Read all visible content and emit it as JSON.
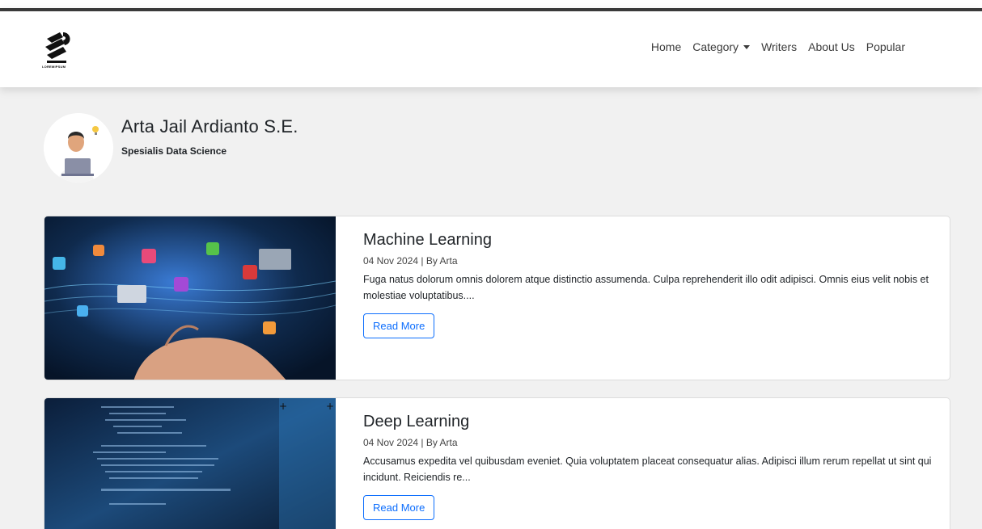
{
  "header": {
    "logo_text": "LOREMIPSUM",
    "nav": {
      "home": "Home",
      "category": "Category",
      "writers": "Writers",
      "about": "About Us",
      "popular": "Popular"
    }
  },
  "profile": {
    "name": "Arta Jail Ardianto S.E.",
    "role": "Spesialis Data Science"
  },
  "articles": [
    {
      "title": "Machine Learning",
      "meta": "04 Nov 2024 | By Arta",
      "excerpt": "Fuga natus dolorum omnis dolorem atque distinctio assumenda. Culpa reprehenderit illo odit adipisci. Omnis eius velit nobis et molestiae voluptatibus....",
      "button": "Read More"
    },
    {
      "title": "Deep Learning",
      "meta": "04 Nov 2024 | By Arta",
      "excerpt": "Accusamus expedita vel quibusdam eveniet. Quia voluptatem placeat consequatur alias. Adipisci illum rerum repellat ut sint qui incidunt. Reiciendis re...",
      "button": "Read More"
    }
  ],
  "colors": {
    "accent": "#0d6efd",
    "background": "#f1f1f1"
  }
}
